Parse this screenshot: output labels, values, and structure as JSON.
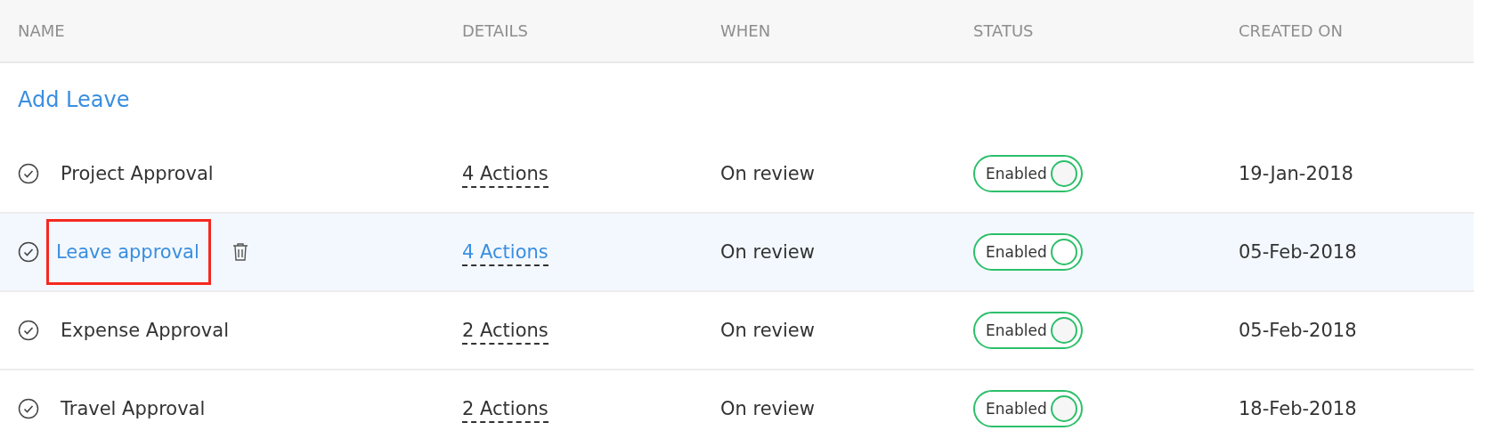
{
  "table": {
    "columns": [
      "NAME",
      "DETAILS",
      "WHEN",
      "STATUS",
      "CREATED ON"
    ],
    "add_link": "Add Leave",
    "rows": [
      {
        "name": "Project Approval",
        "details": "4 Actions",
        "when": "On review",
        "status": "Enabled",
        "status_on": true,
        "created_on": "19-Jan-2018",
        "selected": false,
        "highlighted": false
      },
      {
        "name": "Leave approval",
        "details": "4 Actions",
        "when": "On review",
        "status": "Enabled",
        "status_on": true,
        "created_on": "05-Feb-2018",
        "selected": true,
        "highlighted": true
      },
      {
        "name": "Expense Approval",
        "details": "2 Actions",
        "when": "On review",
        "status": "Enabled",
        "status_on": true,
        "created_on": "05-Feb-2018",
        "selected": false,
        "highlighted": false
      },
      {
        "name": "Travel Approval",
        "details": "2 Actions",
        "when": "On review",
        "status": "Enabled",
        "status_on": true,
        "created_on": "18-Feb-2018",
        "selected": false,
        "highlighted": false
      }
    ]
  }
}
